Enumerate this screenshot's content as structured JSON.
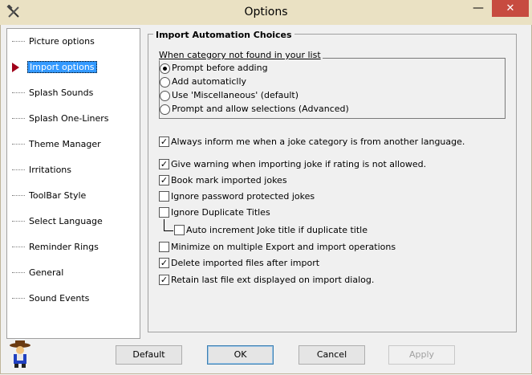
{
  "window": {
    "title": "Options",
    "minimize_glyph": "—",
    "close_glyph": "✕"
  },
  "icons": {
    "app": "hammer-wrench-icon",
    "selected_marker": "red-arrow-icon",
    "mascot": "cowboy-avatar-icon"
  },
  "colors": {
    "titlebar": "#eae1c3",
    "close_button": "#c74b40",
    "selection": "#3399ff",
    "marker": "#a0001a"
  },
  "sidebar": {
    "items": [
      {
        "label": "Picture options",
        "selected": false
      },
      {
        "label": "Import options",
        "selected": true
      },
      {
        "label": "Splash Sounds",
        "selected": false
      },
      {
        "label": "Splash One-Liners",
        "selected": false
      },
      {
        "label": "Theme Manager",
        "selected": false
      },
      {
        "label": "Irritations",
        "selected": false
      },
      {
        "label": "ToolBar Style",
        "selected": false
      },
      {
        "label": "Select Language",
        "selected": false
      },
      {
        "label": "Reminder Rings",
        "selected": false
      },
      {
        "label": "General",
        "selected": false
      },
      {
        "label": "Sound Events",
        "selected": false
      }
    ]
  },
  "panel": {
    "title": "Import Automation Choices",
    "category_group": {
      "title": "When category not found in your list",
      "options": [
        {
          "label": "Prompt before adding",
          "selected": true
        },
        {
          "label": "Add automaticlly",
          "selected": false
        },
        {
          "label": "Use 'Miscellaneous' (default)",
          "selected": false
        },
        {
          "label": "Prompt and allow selections (Advanced)",
          "selected": false
        }
      ]
    },
    "checks": {
      "inform_language": {
        "label": "Always inform me when a joke category is from another language.",
        "checked": true
      },
      "warn_rating": {
        "label": "Give warning when importing joke if rating is not allowed.",
        "checked": true
      },
      "bookmark": {
        "label": "Book mark imported jokes",
        "checked": true
      },
      "ignore_password": {
        "label": "Ignore password protected jokes",
        "checked": false
      },
      "ignore_duplicate": {
        "label": "Ignore Duplicate Titles",
        "checked": false
      },
      "auto_increment": {
        "label": "Auto increment Joke title if duplicate title",
        "checked": false
      },
      "minimize": {
        "label": "Minimize on multiple Export and import operations",
        "checked": false
      },
      "delete_imported": {
        "label": "Delete imported files after import",
        "checked": true
      },
      "retain_ext": {
        "label": "Retain last file ext displayed on import dialog.",
        "checked": true
      }
    }
  },
  "buttons": {
    "default": "Default",
    "ok": "OK",
    "cancel": "Cancel",
    "apply": "Apply"
  }
}
